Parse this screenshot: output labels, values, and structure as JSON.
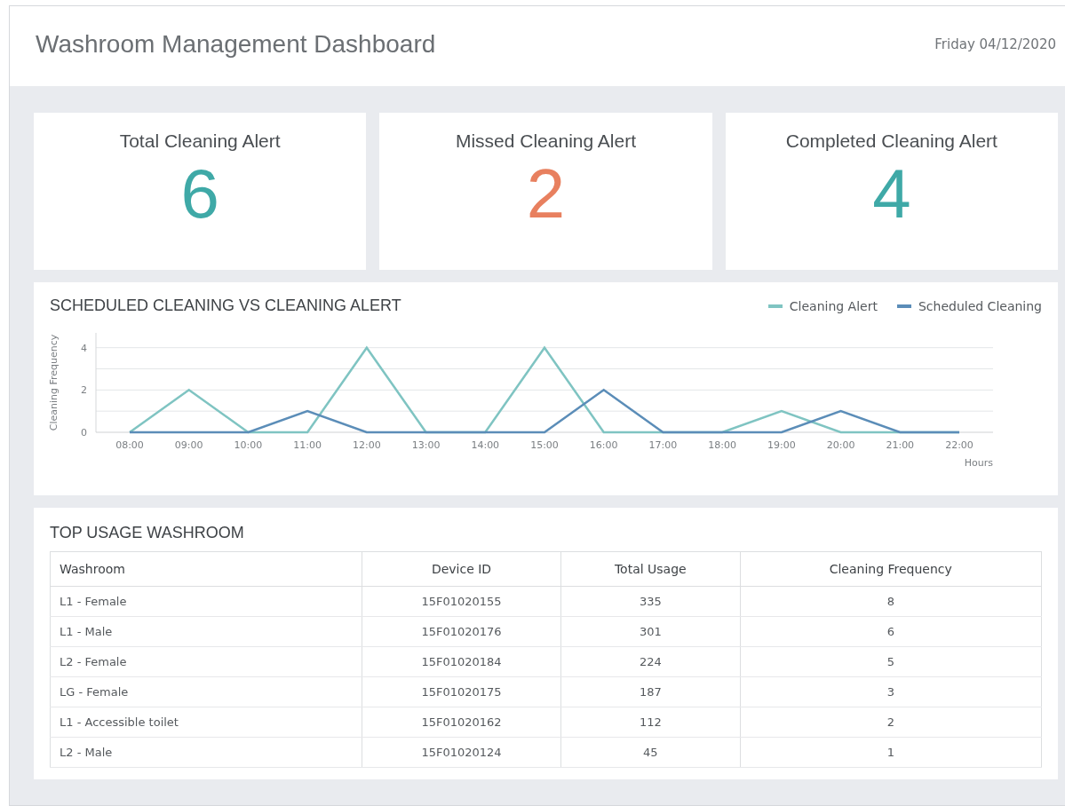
{
  "header": {
    "title": "Washroom Management Dashboard",
    "date": "Friday 04/12/2020"
  },
  "stats": [
    {
      "label": "Total Cleaning Alert",
      "value": "6",
      "color": "#3fa9a7"
    },
    {
      "label": "Missed Cleaning Alert",
      "value": "2",
      "color": "#e8805f"
    },
    {
      "label": "Completed Cleaning Alert",
      "value": "4",
      "color": "#3fa9a7"
    }
  ],
  "chart_panel": {
    "title": "SCHEDULED CLEANING VS CLEANING ALERT",
    "chart_data": {
      "type": "line",
      "xlabel": "Hours",
      "ylabel": "Cleaning Frequency",
      "categories": [
        "08:00",
        "09:00",
        "10:00",
        "11:00",
        "12:00",
        "13:00",
        "14:00",
        "15:00",
        "16:00",
        "17:00",
        "18:00",
        "19:00",
        "20:00",
        "21:00",
        "22:00"
      ],
      "ylim": [
        0,
        4.7
      ],
      "yticks": [
        0,
        2,
        4
      ],
      "series": [
        {
          "name": "Cleaning Alert",
          "color": "#7fc4c2",
          "values": [
            0,
            2,
            0,
            0,
            4,
            0,
            0,
            4,
            0,
            0,
            0,
            1,
            0,
            0,
            0
          ]
        },
        {
          "name": "Scheduled Cleaning",
          "color": "#5b8db8",
          "values": [
            0,
            0,
            0,
            1,
            0,
            0,
            0,
            0,
            2,
            0,
            0,
            0,
            1,
            0,
            0
          ]
        }
      ]
    }
  },
  "table_panel": {
    "title": "TOP USAGE WASHROOM",
    "columns": [
      "Washroom",
      "Device ID",
      "Total Usage",
      "Cleaning Frequency"
    ],
    "rows": [
      [
        "L1 - Female",
        "15F01020155",
        "335",
        "8"
      ],
      [
        "L1 - Male",
        "15F01020176",
        "301",
        "6"
      ],
      [
        "L2 - Female",
        "15F01020184",
        "224",
        "5"
      ],
      [
        "LG - Female",
        "15F01020175",
        "187",
        "3"
      ],
      [
        "L1 - Accessible toilet",
        "15F01020162",
        "112",
        "2"
      ],
      [
        "L2 - Male",
        "15F01020124",
        "45",
        "1"
      ]
    ]
  }
}
